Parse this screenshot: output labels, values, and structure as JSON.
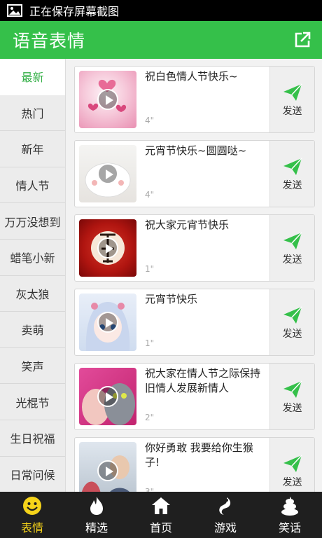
{
  "status_bar": {
    "text": "正在保存屏幕截图"
  },
  "header": {
    "title": "语音表情"
  },
  "sidebar": {
    "items": [
      {
        "label": "最新"
      },
      {
        "label": "热门"
      },
      {
        "label": "新年"
      },
      {
        "label": "情人节"
      },
      {
        "label": "万万没想到"
      },
      {
        "label": "蜡笔小新"
      },
      {
        "label": "灰太狼"
      },
      {
        "label": "卖萌"
      },
      {
        "label": "笑声"
      },
      {
        "label": "光棍节"
      },
      {
        "label": "生日祝福"
      },
      {
        "label": "日常问候"
      }
    ]
  },
  "cards": [
    {
      "title": "祝白色情人节快乐~",
      "duration": "4\"",
      "send": "发送"
    },
    {
      "title": "元宵节快乐~圆圆哒~",
      "duration": "4\"",
      "send": "发送"
    },
    {
      "title": "祝大家元宵节快乐",
      "duration": "1\"",
      "send": "发送"
    },
    {
      "title": "元宵节快乐",
      "duration": "1\"",
      "send": "发送"
    },
    {
      "title": "祝大家在情人节之际保持旧情人发展新情人",
      "duration": "2\"",
      "send": "发送"
    },
    {
      "title": "你好勇敢 我要给你生猴子!",
      "duration": "3\"",
      "send": "发送"
    }
  ],
  "tabs": [
    {
      "label": "表情",
      "icon": "smiley-icon"
    },
    {
      "label": "精选",
      "icon": "flame-icon"
    },
    {
      "label": "首页",
      "icon": "home-icon"
    },
    {
      "label": "游戏",
      "icon": "game-icon"
    },
    {
      "label": "笑话",
      "icon": "poop-icon"
    }
  ],
  "colors": {
    "brand_green": "#35c04a",
    "active_tab": "#f5d31a"
  }
}
